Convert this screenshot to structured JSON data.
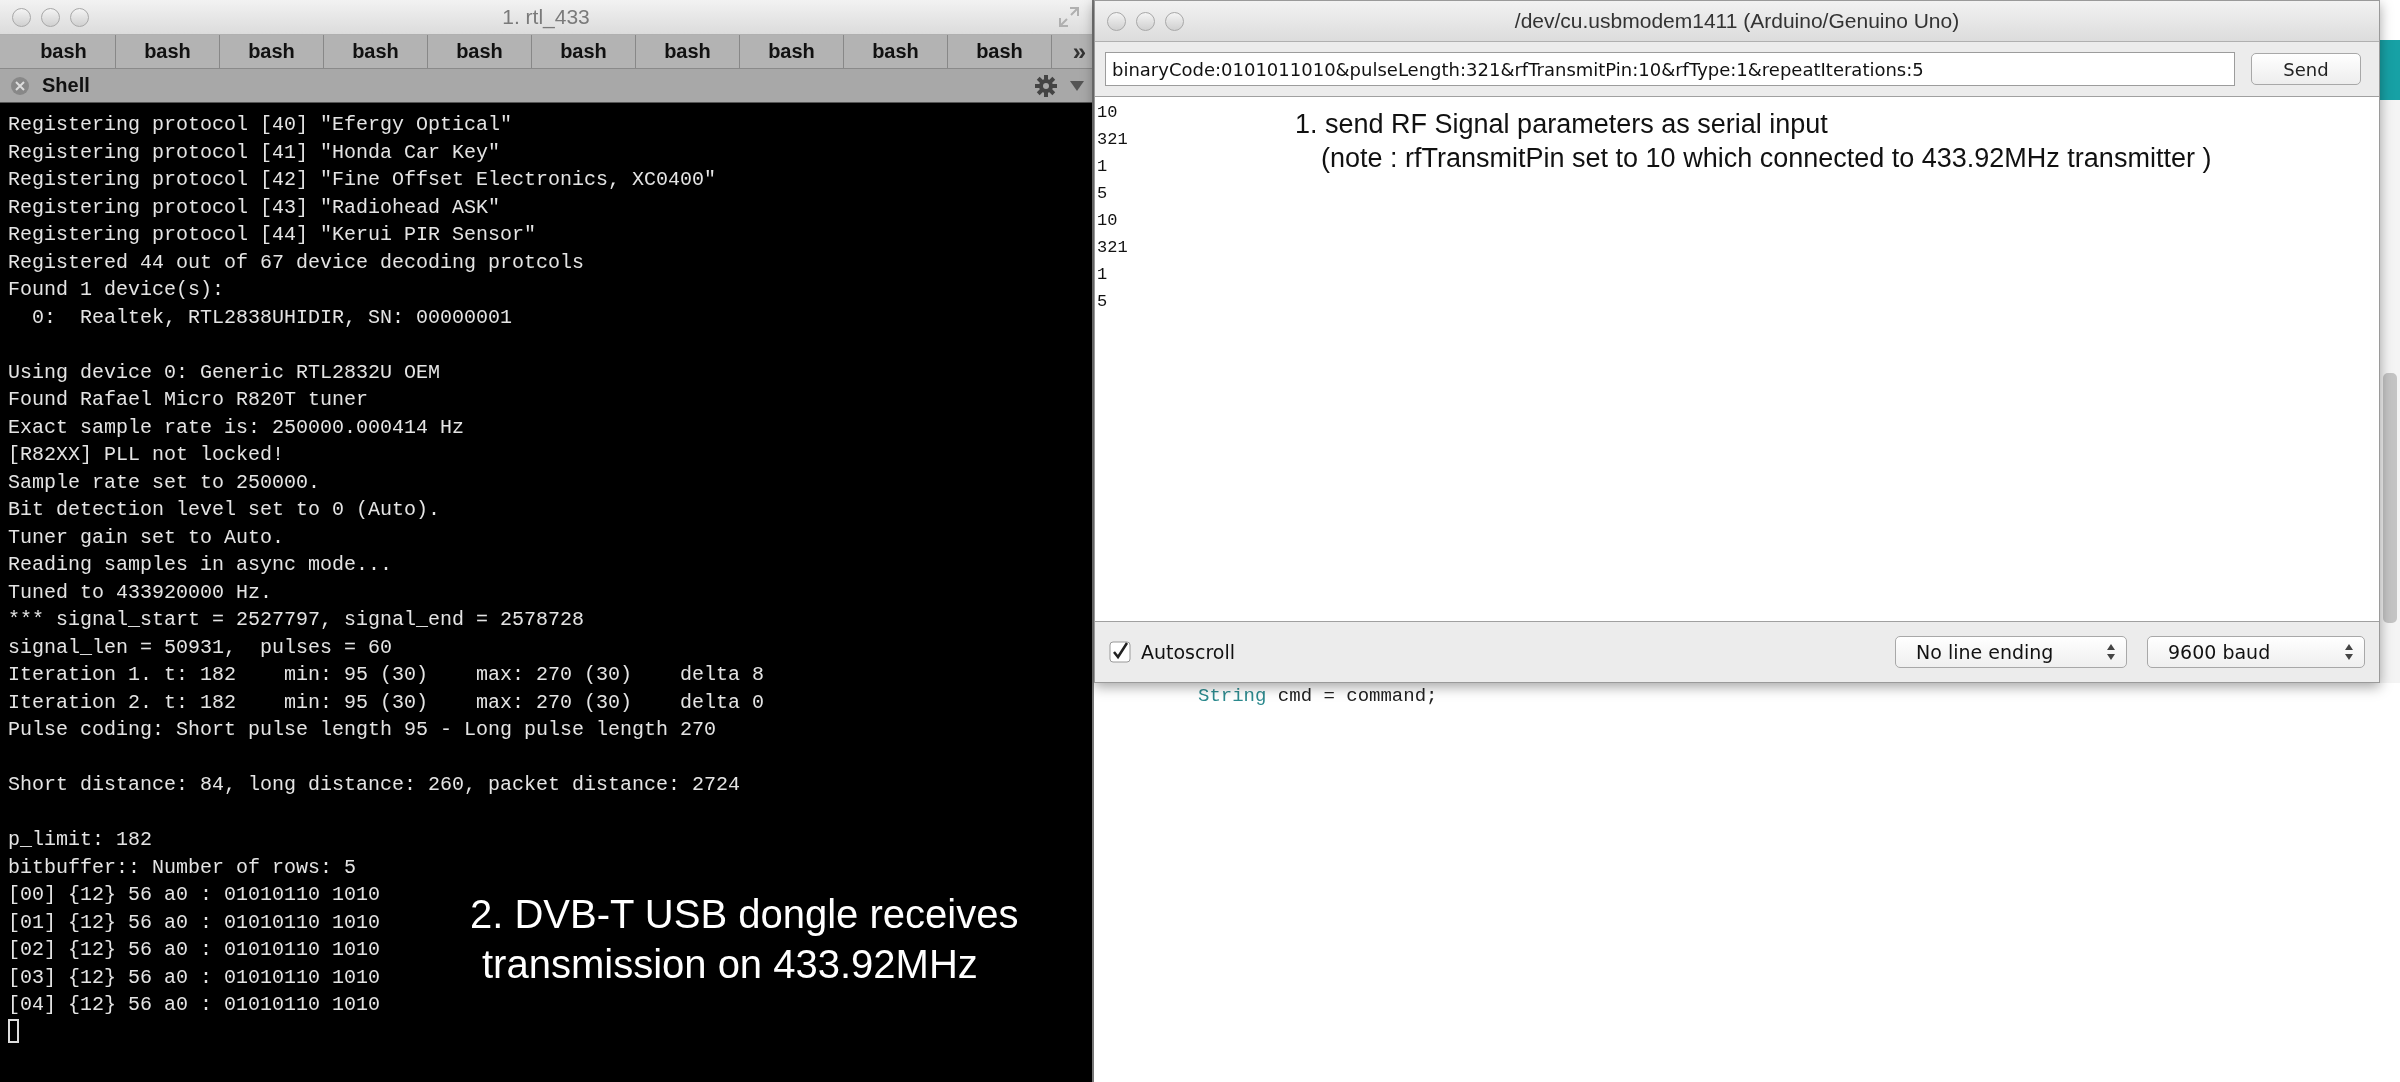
{
  "terminal_window": {
    "title": "1. rtl_433",
    "tabs": [
      "bash",
      "bash",
      "bash",
      "bash",
      "bash",
      "bash",
      "bash",
      "bash",
      "bash",
      "bash"
    ],
    "overflow": "»",
    "panel_title": "Shell",
    "blocks": [
      [
        "Registering protocol [40] \"Efergy Optical\"",
        "Registering protocol [41] \"Honda Car Key\"",
        "Registering protocol [42] \"Fine Offset Electronics, XC0400\"",
        "Registering protocol [43] \"Radiohead ASK\"",
        "Registering protocol [44] \"Kerui PIR Sensor\"",
        "Registered 44 out of 67 device decoding protcols",
        "Found 1 device(s):",
        "  0:  Realtek, RTL2838UHIDIR, SN: 00000001"
      ],
      [
        "Using device 0: Generic RTL2832U OEM",
        "Found Rafael Micro R820T tuner",
        "Exact sample rate is: 250000.000414 Hz",
        "[R82XX] PLL not locked!",
        "Sample rate set to 250000.",
        "Bit detection level set to 0 (Auto).",
        "Tuner gain set to Auto.",
        "Reading samples in async mode...",
        "Tuned to 433920000 Hz.",
        "*** signal_start = 2527797, signal_end = 2578728",
        "signal_len = 50931,  pulses = 60",
        "Iteration 1. t: 182    min: 95 (30)    max: 270 (30)    delta 8",
        "Iteration 2. t: 182    min: 95 (30)    max: 270 (30)    delta 0",
        "Pulse coding: Short pulse length 95 - Long pulse length 270"
      ],
      [
        "Short distance: 84, long distance: 260, packet distance: 2724"
      ],
      [
        "p_limit: 182",
        "bitbuffer:: Number of rows: 5",
        "[00] {12} 56 a0 : 01010110 1010",
        "[01] {12} 56 a0 : 01010110 1010",
        "[02] {12} 56 a0 : 01010110 1010",
        "[03] {12} 56 a0 : 01010110 1010",
        "[04] {12} 56 a0 : 01010110 1010"
      ]
    ],
    "annotation": [
      "2. DVB-T USB dongle receives",
      "transmission on 433.92MHz"
    ]
  },
  "serial_monitor": {
    "title": "/dev/cu.usbmodem1411 (Arduino/Genuino Uno)",
    "input_value": "binaryCode:0101011010&pulseLength:321&rfTransmitPin:10&rfType:1&repeatIterations:5",
    "send_button": "Send",
    "output": [
      "10",
      "321",
      "1",
      "5",
      "10",
      "321",
      "1",
      "5"
    ],
    "annotation": [
      "1. send RF Signal parameters as serial input",
      "(note : rfTransmitPin set to 10 which connected to 433.92MHz transmitter )"
    ],
    "autoscroll": {
      "label": "Autoscroll",
      "checked": true
    },
    "line_ending": "No line ending",
    "baud": "9600 baud"
  },
  "editor": {
    "code_line": [
      {
        "text": "String",
        "kind": "type"
      },
      {
        "text": " cmd = command;",
        "kind": "plain"
      }
    ]
  }
}
